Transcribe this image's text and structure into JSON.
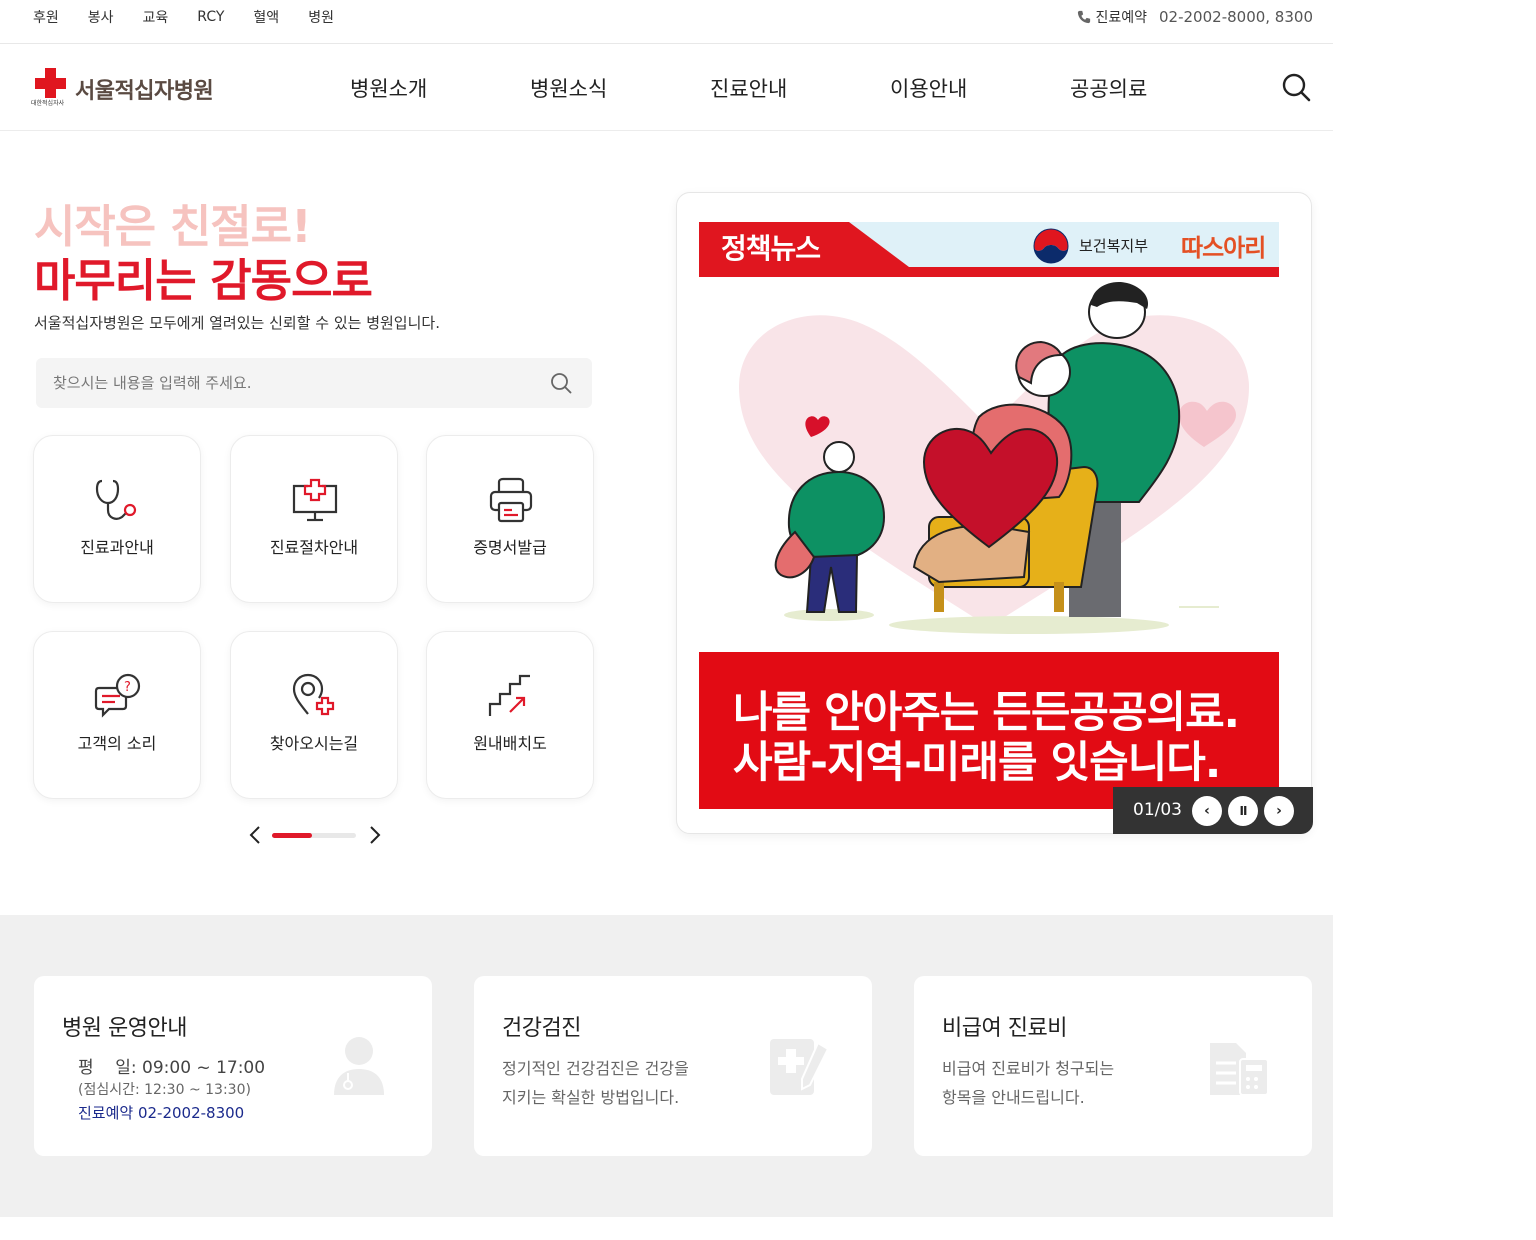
{
  "util": {
    "links": [
      "후원",
      "봉사",
      "교육",
      "RCY",
      "혈액",
      "병원"
    ],
    "reservation_label": "진료예약",
    "reservation_phone": "02-2002-8000, 8300"
  },
  "header": {
    "logo_small": "대한적십자사",
    "logo_text": "서울적십자병원",
    "nav": [
      "병원소개",
      "병원소식",
      "진료안내",
      "이용안내",
      "공공의료"
    ]
  },
  "hero": {
    "title_line1": "시작은 친절로!",
    "title_line2": "마무리는 감동으로",
    "description": "서울적십자병원은 모두에게 열려있는 신뢰할 수 있는 병원입니다.",
    "search_placeholder": "찾으시는 내용을 입력해 주세요."
  },
  "quick_menu": {
    "items": [
      {
        "label": "진료과안내",
        "icon": "stethoscope-icon"
      },
      {
        "label": "진료절차안내",
        "icon": "medical-monitor-icon"
      },
      {
        "label": "증명서발급",
        "icon": "printer-icon"
      },
      {
        "label": "고객의 소리",
        "icon": "speech-bubble-icon"
      },
      {
        "label": "찾아오시는길",
        "icon": "location-pin-icon"
      },
      {
        "label": "원내배치도",
        "icon": "stairs-icon"
      }
    ],
    "progress": 0.48
  },
  "banner": {
    "tag": "정책뉴스",
    "ministry": "보건복지부",
    "brand": "따스아리",
    "headline_line1": "나를 안아주는 든든공공의료.",
    "headline_line2": "사람-지역-미래를 잇습니다.",
    "counter": "01/03",
    "pause_symbol": "II",
    "prev_symbol": "‹",
    "next_symbol": "›"
  },
  "info_cards": {
    "hours": {
      "title": "병원 운영안내",
      "weekday": "평    일: 09:00 ~ 17:00",
      "lunch": "(점심시간: 12:30 ~ 13:30)",
      "reservation": "진료예약 02-2002-8300"
    },
    "checkup": {
      "title": "건강검진",
      "desc_line1": "정기적인 건강검진은 건강을",
      "desc_line2": "지키는 확실한 방법입니다."
    },
    "fees": {
      "title": "비급여 진료비",
      "desc_line1": "비급여 진료비가 청구되는",
      "desc_line2": "항목을 안내드립니다."
    }
  },
  "colors": {
    "brand_red": "#e0192a",
    "title_pink": "#f6c3bf",
    "logo_brown": "#5a4a42",
    "link_navy": "#1b2a8c"
  }
}
